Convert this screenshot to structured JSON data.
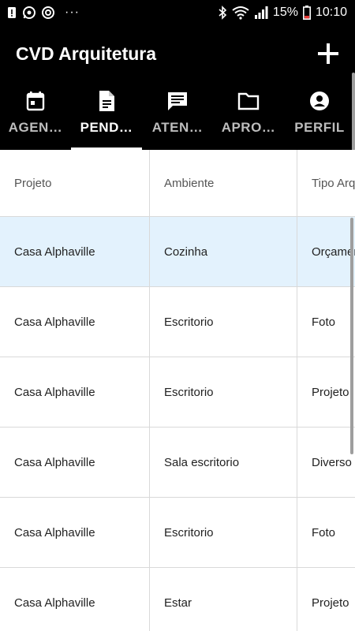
{
  "status_bar": {
    "battery_percent": "15%",
    "time": "10:10",
    "more": "···",
    "icons": [
      "alert-icon",
      "whatsapp-icon",
      "sync-icon",
      "bluetooth-icon",
      "wifi-icon",
      "signal-icon",
      "battery-icon"
    ]
  },
  "app_bar": {
    "title": "CVD Arquitetura",
    "add_icon": "plus-icon"
  },
  "tabs": [
    {
      "label": "AGEN…",
      "icon": "calendar-icon",
      "active": false
    },
    {
      "label": "PEND…",
      "icon": "document-icon",
      "active": true
    },
    {
      "label": "ATEN…",
      "icon": "chat-icon",
      "active": false
    },
    {
      "label": "APRO…",
      "icon": "folder-icon",
      "active": false
    },
    {
      "label": "PERFIL",
      "icon": "account-icon",
      "active": false
    }
  ],
  "table": {
    "columns": [
      "Projeto",
      "Ambiente",
      "Tipo Arq"
    ],
    "rows": [
      [
        "Casa Alphaville",
        "Cozinha",
        "Orçamen"
      ],
      [
        "Casa Alphaville",
        "Escritorio",
        "Foto"
      ],
      [
        "Casa Alphaville",
        "Escritorio",
        "Projeto"
      ],
      [
        "Casa Alphaville",
        "Sala escritorio",
        "Diverso"
      ],
      [
        "Casa Alphaville",
        "Escritorio",
        "Foto"
      ],
      [
        "Casa Alphaville",
        "Estar",
        "Projeto"
      ]
    ],
    "selected_row": 0,
    "selected_color": "#e3f2fd"
  }
}
